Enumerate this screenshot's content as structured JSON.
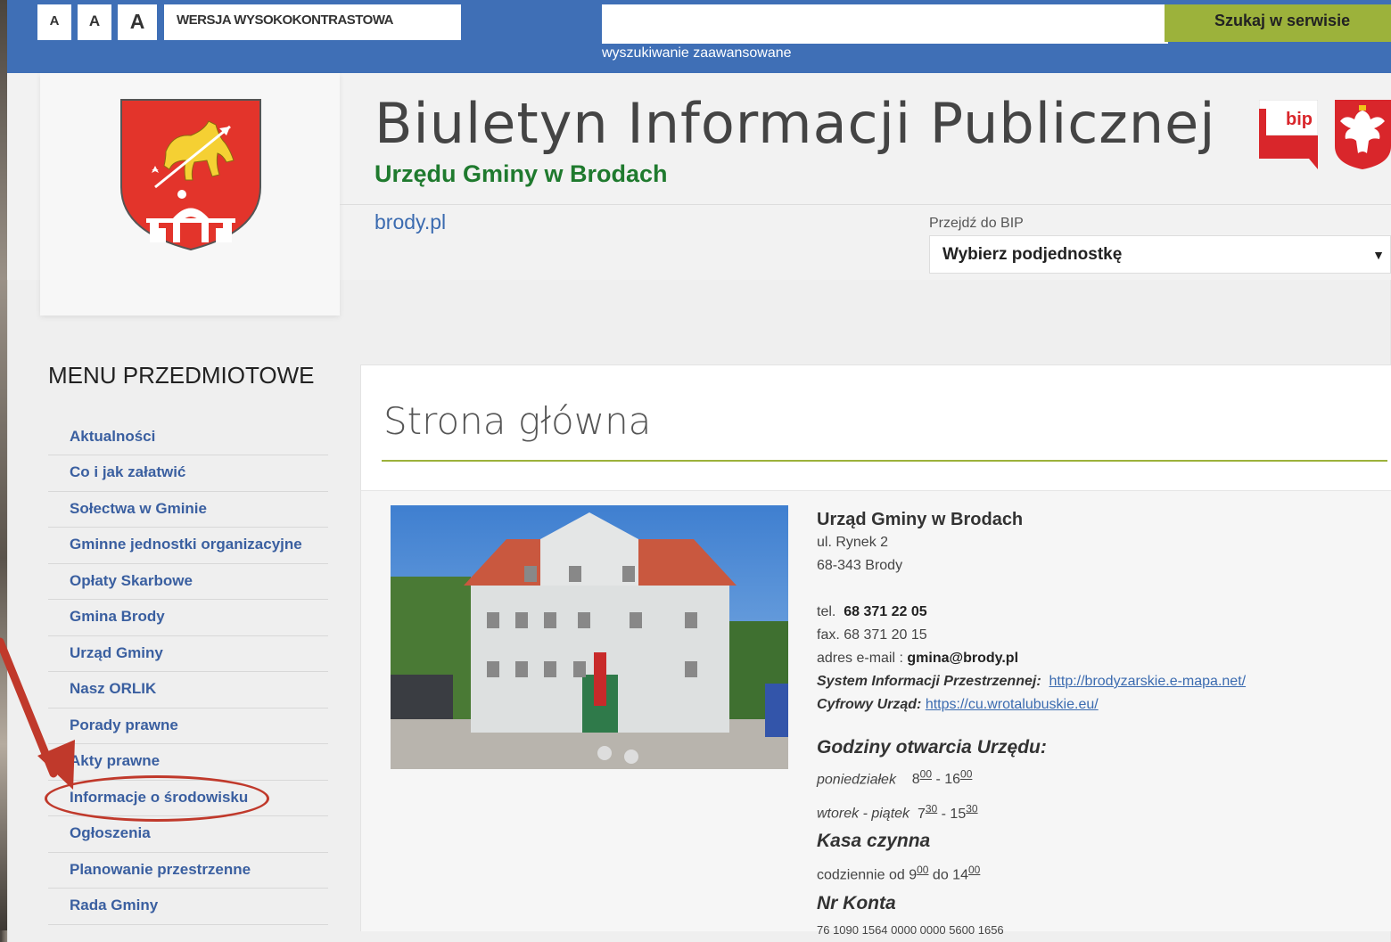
{
  "top": {
    "font_small": "A",
    "font_medium": "A",
    "font_large": "A",
    "high_contrast": "WERSJA WYSOKOKONTRASTOWA",
    "search_placeholder": "",
    "search_button": "Szukaj w serwisie",
    "advanced_search": "wyszukiwanie zaawansowane"
  },
  "header": {
    "title": "Biuletyn Informacji Publicznej",
    "subtitle": "Urzędu Gminy w Brodach",
    "site_link": "brody.pl",
    "goto_label": "Przejdź do BIP",
    "select_value": "Wybierz podjednostkę",
    "bip_logo_text": "bip"
  },
  "sidebar": {
    "heading": "MENU PRZEDMIOTOWE",
    "items": [
      {
        "label": "Aktualności"
      },
      {
        "label": "Co i jak załatwić"
      },
      {
        "label": "Sołectwa w Gminie"
      },
      {
        "label": "Gminne jednostki organizacyjne"
      },
      {
        "label": "Opłaty Skarbowe"
      },
      {
        "label": "Gmina Brody"
      },
      {
        "label": "Urząd Gminy"
      },
      {
        "label": "Nasz ORLIK"
      },
      {
        "label": "Porady prawne"
      },
      {
        "label": "Akty prawne"
      },
      {
        "label": "Informacje o środowisku"
      },
      {
        "label": "Ogłoszenia"
      },
      {
        "label": "Planowanie przestrzenne"
      },
      {
        "label": "Rada Gminy"
      }
    ]
  },
  "main": {
    "page_title": "Strona główna",
    "office_name": "Urząd Gminy w Brodach",
    "street": "ul. Rynek 2",
    "postal": "68-343 Brody",
    "tel_label": "tel.",
    "tel": "68 371 22 05",
    "fax": "fax. 68 371 20 15",
    "email_label": "adres e-mail :",
    "email": "gmina@brody.pl",
    "sip_label": "System Informacji Przestrzennej:",
    "sip_url": "http://brodyzarskie.e-mapa.net/",
    "cu_label": "Cyfrowy Urząd:",
    "cu_url": "https://cu.wrotalubuskie.eu/",
    "hours_heading": "Godziny otwarcia Urzędu:",
    "mon_label": "poniedziałek",
    "mon_from": "8",
    "mon_from_min": "00",
    "mon_to": "16",
    "mon_to_min": "00",
    "tue_label": "wtorek - piątek",
    "tue_from": "7",
    "tue_from_min": "30",
    "tue_to": "15",
    "tue_to_min": "30",
    "cash_heading": "Kasa czynna",
    "cash_text": "codziennie od",
    "cash_from": "9",
    "cash_from_min": "00",
    "cash_do": "do",
    "cash_to": "14",
    "cash_to_min": "00",
    "account_heading": "Nr Konta",
    "account_number": "76 1090 1564 0000 0000 5600 1656"
  },
  "colors": {
    "topbar": "#3f6fb6",
    "search_button": "#9cb23b",
    "annotation": "#c0392b",
    "subtitle": "#1f7a2e"
  }
}
